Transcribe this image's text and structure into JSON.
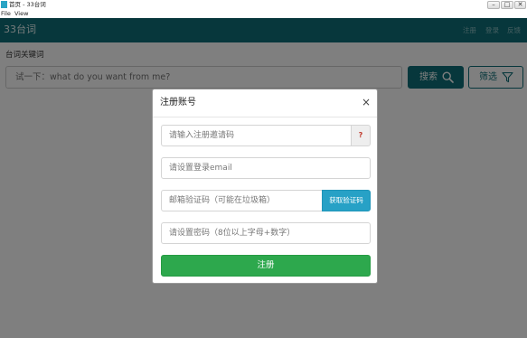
{
  "window": {
    "title": "首页 - 33台词",
    "controls": {
      "minimize": "–",
      "maximize": "□",
      "close": "✕"
    }
  },
  "menubar": {
    "items": [
      {
        "label": "File"
      },
      {
        "label": "View"
      }
    ]
  },
  "header": {
    "logo": "33台词",
    "nav": [
      {
        "label": "注册"
      },
      {
        "label": "登录"
      },
      {
        "label": "反馈"
      }
    ]
  },
  "search": {
    "label": "台词关键词",
    "placeholder": "试一下：what do you want from me?",
    "search_button": "搜索",
    "filter_button": "筛选"
  },
  "modal": {
    "title": "注册账号",
    "close": "×",
    "invite_placeholder": "请输入注册邀请码",
    "invite_help": "?",
    "email_placeholder": "请设置登录email",
    "code_placeholder": "邮箱验证码（可能在垃圾箱）",
    "code_button": "获取验证码",
    "password_placeholder": "请设置密码（8位以上字母+数字）",
    "submit": "注册"
  },
  "colors": {
    "header_bg": "#0e6f78",
    "register_button": "#2da84d",
    "code_button": "#27a1c6",
    "help_icon": "#c0392b"
  },
  "icons": {
    "search": "search-icon",
    "filter": "filter-icon"
  }
}
